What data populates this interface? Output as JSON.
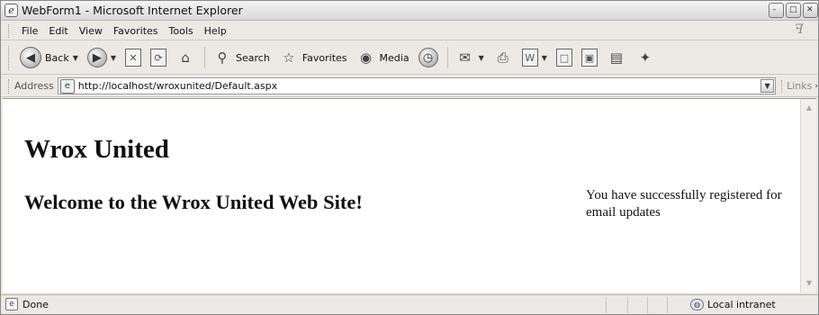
{
  "window": {
    "title": "WebForm1 - Microsoft Internet Explorer",
    "controls": {
      "minimize": "–",
      "maximize": "□",
      "close": "✕"
    }
  },
  "menubar": {
    "items": [
      {
        "label": "File"
      },
      {
        "label": "Edit"
      },
      {
        "label": "View"
      },
      {
        "label": "Favorites"
      },
      {
        "label": "Tools"
      },
      {
        "label": "Help"
      }
    ]
  },
  "toolbar": {
    "back_label": "Back",
    "search_label": "Search",
    "favorites_label": "Favorites",
    "media_label": "Media",
    "glyphs": {
      "back": "◀",
      "forward": "▶",
      "stop": "✕",
      "refresh": "⟳",
      "home": "⌂",
      "search": "⚲",
      "favorites": "☆",
      "media": "◉",
      "history": "◷",
      "mail": "✉",
      "print": "⎙",
      "edit": "W",
      "discuss": "□",
      "messenger": "✦"
    }
  },
  "address": {
    "label": "Address",
    "url": "http://localhost/wroxunited/Default.aspx",
    "links_label": "Links"
  },
  "page": {
    "heading": "Wrox United",
    "welcome": "Welcome to the Wrox United Web Site!",
    "message": "You have successfully registered for email updates"
  },
  "status": {
    "text": "Done",
    "zone": "Local intranet"
  },
  "colors": {
    "chrome": "#ece9e4",
    "content_bg": "#ffffff",
    "text": "#111111"
  }
}
